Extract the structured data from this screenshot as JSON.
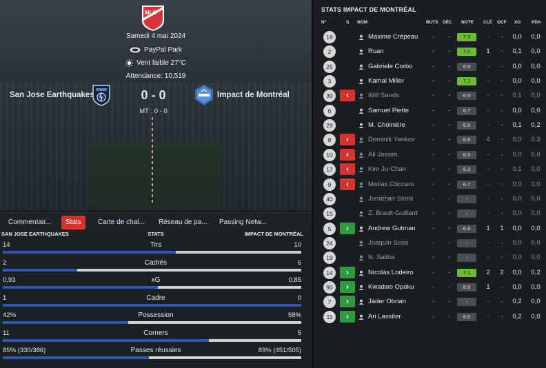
{
  "match": {
    "date": "Samedi 4 mai 2024",
    "venue": "PayPal Park",
    "weather": "Vent faible 27°C",
    "attendance": "Attendance: 10,519",
    "home_team": "San Jose Earthquakes",
    "away_team": "Impact de Montréal",
    "score": "0 - 0",
    "halftime": "MT : 0 - 0",
    "logo_text": "MLS"
  },
  "tabs": [
    "Commentair...",
    "Stats",
    "Carte de chal...",
    "Réseau de pa...",
    "Passing Netw..."
  ],
  "active_tab": 1,
  "stats_header": {
    "home": "SAN JOSE EARTHQUAKES",
    "center": "STATS",
    "away": "IMPACT DE MONTRÉAL"
  },
  "stats": [
    {
      "label": "Tirs",
      "home": "14",
      "away": "10",
      "home_share": 0.58
    },
    {
      "label": "Cadrés",
      "home": "2",
      "away": "6",
      "home_share": 0.25
    },
    {
      "label": "xG",
      "home": "0,93",
      "away": "0,85",
      "home_share": 0.52
    },
    {
      "label": "Cadre",
      "home": "1",
      "away": "0",
      "home_share": 1.0
    },
    {
      "label": "Possession",
      "home": "42%",
      "away": "58%",
      "home_share": 0.42
    },
    {
      "label": "Corners",
      "home": "11",
      "away": "5",
      "home_share": 0.69
    },
    {
      "label": "Passes réussies",
      "home": "85% (330/386)",
      "away": "89% (451/505)",
      "home_share": 0.49
    }
  ],
  "players_panel": {
    "title": "STATS IMPACT DE MONTRÉAL",
    "columns": {
      "num": "N°",
      "s": "S",
      "name": "NOM",
      "buts": "BUTS",
      "dec": "DÉC",
      "note": "NOTE",
      "cle": "CLÉ",
      "ocf": "OCF",
      "xg": "XG",
      "pda": "PDA"
    },
    "players": [
      {
        "num": "18",
        "sub": "",
        "name": "Maxime Crépeau",
        "buts": "-",
        "dec": "-",
        "note": "7.3",
        "good": true,
        "cle": "-",
        "ocf": "-",
        "xg": "0,0",
        "pda": "0,0",
        "dim": false
      },
      {
        "num": "2",
        "sub": "",
        "name": "Ruan",
        "buts": "-",
        "dec": "-",
        "note": "7.0",
        "good": true,
        "cle": "1",
        "ocf": "-",
        "xg": "0,1",
        "pda": "0,0",
        "dim": false
      },
      {
        "num": "25",
        "sub": "",
        "name": "Gabriele Corbo",
        "buts": "-",
        "dec": "-",
        "note": "6.9",
        "good": false,
        "cle": "-",
        "ocf": "-",
        "xg": "0,0",
        "pda": "0,0",
        "dim": false
      },
      {
        "num": "3",
        "sub": "",
        "name": "Kamal Miller",
        "buts": "-",
        "dec": "-",
        "note": "7.1",
        "good": true,
        "cle": "-",
        "ocf": "-",
        "xg": "0,0",
        "pda": "0,0",
        "dim": false
      },
      {
        "num": "30",
        "sub": "out",
        "name": "Will Sands",
        "buts": "-",
        "dec": "-",
        "note": "6.9",
        "good": false,
        "cle": "-",
        "ocf": "-",
        "xg": "0,1",
        "pda": "0,0",
        "dim": true
      },
      {
        "num": "6",
        "sub": "",
        "name": "Samuel Piette",
        "buts": "-",
        "dec": "-",
        "note": "6.7",
        "good": false,
        "cle": "-",
        "ocf": "-",
        "xg": "0,0",
        "pda": "0,0",
        "dim": false
      },
      {
        "num": "29",
        "sub": "",
        "name": "M. Choinière",
        "buts": "-",
        "dec": "-",
        "note": "6.9",
        "good": false,
        "cle": "-",
        "ocf": "-",
        "xg": "0,1",
        "pda": "0,2",
        "dim": false
      },
      {
        "num": "8",
        "sub": "out",
        "name": "Dominik Yankov",
        "buts": "-",
        "dec": "-",
        "note": "6.8",
        "good": false,
        "cle": "4",
        "ocf": "-",
        "xg": "0,0",
        "pda": "0,3",
        "dim": true
      },
      {
        "num": "10",
        "sub": "out",
        "name": "Ali Jassim",
        "buts": "-",
        "dec": "-",
        "note": "6.5",
        "good": false,
        "cle": "-",
        "ocf": "-",
        "xg": "0,0",
        "pda": "0,0",
        "dim": true
      },
      {
        "num": "17",
        "sub": "out",
        "name": "Kim Ju-Chan",
        "buts": "-",
        "dec": "-",
        "note": "6.3",
        "good": false,
        "cle": "-",
        "ocf": "-",
        "xg": "0,1",
        "pda": "0,0",
        "dim": true
      },
      {
        "num": "9",
        "sub": "out",
        "name": "Matías Cóccaro",
        "buts": "-",
        "dec": "-",
        "note": "6.7",
        "good": false,
        "cle": "-",
        "ocf": "-",
        "xg": "0,0",
        "pda": "0,0",
        "dim": true
      },
      {
        "num": "40",
        "sub": "",
        "name": "Jonathan Sirois",
        "buts": "-",
        "dec": "-",
        "note": "-",
        "good": false,
        "cle": "-",
        "ocf": "-",
        "xg": "0,0",
        "pda": "0,0",
        "dim": true
      },
      {
        "num": "15",
        "sub": "",
        "name": "Z. Brault-Guillard",
        "buts": "-",
        "dec": "-",
        "note": "-",
        "good": false,
        "cle": "-",
        "ocf": "-",
        "xg": "0,0",
        "pda": "0,0",
        "dim": true
      },
      {
        "num": "5",
        "sub": "in",
        "name": "Andrew Gutman",
        "buts": "-",
        "dec": "-",
        "note": "6.8",
        "good": false,
        "cle": "1",
        "ocf": "1",
        "xg": "0,0",
        "pda": "0,0",
        "dim": false
      },
      {
        "num": "24",
        "sub": "",
        "name": "Joaquín Sosa",
        "buts": "-",
        "dec": "-",
        "note": "-",
        "good": false,
        "cle": "-",
        "ocf": "-",
        "xg": "0,0",
        "pda": "0,0",
        "dim": true
      },
      {
        "num": "19",
        "sub": "",
        "name": "N. Saliba",
        "buts": "-",
        "dec": "-",
        "note": "-",
        "good": false,
        "cle": "-",
        "ocf": "-",
        "xg": "0,0",
        "pda": "0,0",
        "dim": true
      },
      {
        "num": "14",
        "sub": "in",
        "name": "Nicolás Lodeiro",
        "buts": "-",
        "dec": "-",
        "note": "7.1",
        "good": true,
        "cle": "2",
        "ocf": "2",
        "xg": "0,0",
        "pda": "0,2",
        "dim": false
      },
      {
        "num": "90",
        "sub": "in",
        "name": "Kwadwo Opoku",
        "buts": "-",
        "dec": "-",
        "note": "6.6",
        "good": false,
        "cle": "1",
        "ocf": "-",
        "xg": "0,0",
        "pda": "0,0",
        "dim": false
      },
      {
        "num": "7",
        "sub": "in",
        "name": "Jáder Obrian",
        "buts": "-",
        "dec": "-",
        "note": "-",
        "good": false,
        "cle": "-",
        "ocf": "-",
        "xg": "0,2",
        "pda": "0,0",
        "dim": false
      },
      {
        "num": "11",
        "sub": "in",
        "name": "Ari Lassiter",
        "buts": "-",
        "dec": "-",
        "note": "6.6",
        "good": false,
        "cle": "-",
        "ocf": "-",
        "xg": "0,2",
        "pda": "0,0",
        "dim": false
      }
    ]
  },
  "colors": {
    "accent": "#d9302b",
    "bar_home": "#2f55b5",
    "bar_away": "#cfcfcf",
    "note_good": "#6dbb2e",
    "sub_in": "#2f9a3b",
    "sub_out": "#d4322c"
  }
}
